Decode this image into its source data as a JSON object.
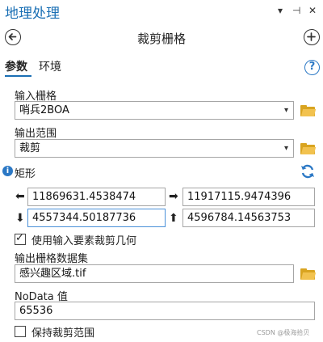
{
  "panel": {
    "title": "地理处理",
    "controls": {
      "menu": "▾",
      "pin": "⊣",
      "close": "✕"
    }
  },
  "tool": {
    "back_icon": "arrow-left-circle-icon",
    "title": "裁剪栅格",
    "add_icon": "plus-circle-icon"
  },
  "tabs": [
    {
      "label": "参数",
      "active": true
    },
    {
      "label": "环境",
      "active": false
    }
  ],
  "params": {
    "input_raster": {
      "label": "输入栅格",
      "value": "哨兵2BOA"
    },
    "output_extent": {
      "label": "输出范围",
      "value": "裁剪"
    },
    "rectangle": {
      "label": "矩形",
      "left": "11869631.4538474",
      "right": "11917115.9474396",
      "bottom": "4557344.50187736",
      "top": "4596784.14563753"
    },
    "use_input_features": {
      "label": "使用输入要素裁剪几何",
      "checked": true
    },
    "output_raster": {
      "label": "输出栅格数据集",
      "value": "感兴趣区域.tif"
    },
    "nodata": {
      "label": "NoData 值",
      "value": "65536"
    },
    "maintain_extent": {
      "label": "保持裁剪范围",
      "checked": false
    }
  },
  "arrows": {
    "left": "⬅",
    "right": "➡",
    "down": "⬇",
    "up": "⬆"
  },
  "watermark": "CSDN @极海拾贝",
  "colors": {
    "accent": "#1a6fb4",
    "folder": "#f2c24f",
    "info": "#2b78c5"
  }
}
